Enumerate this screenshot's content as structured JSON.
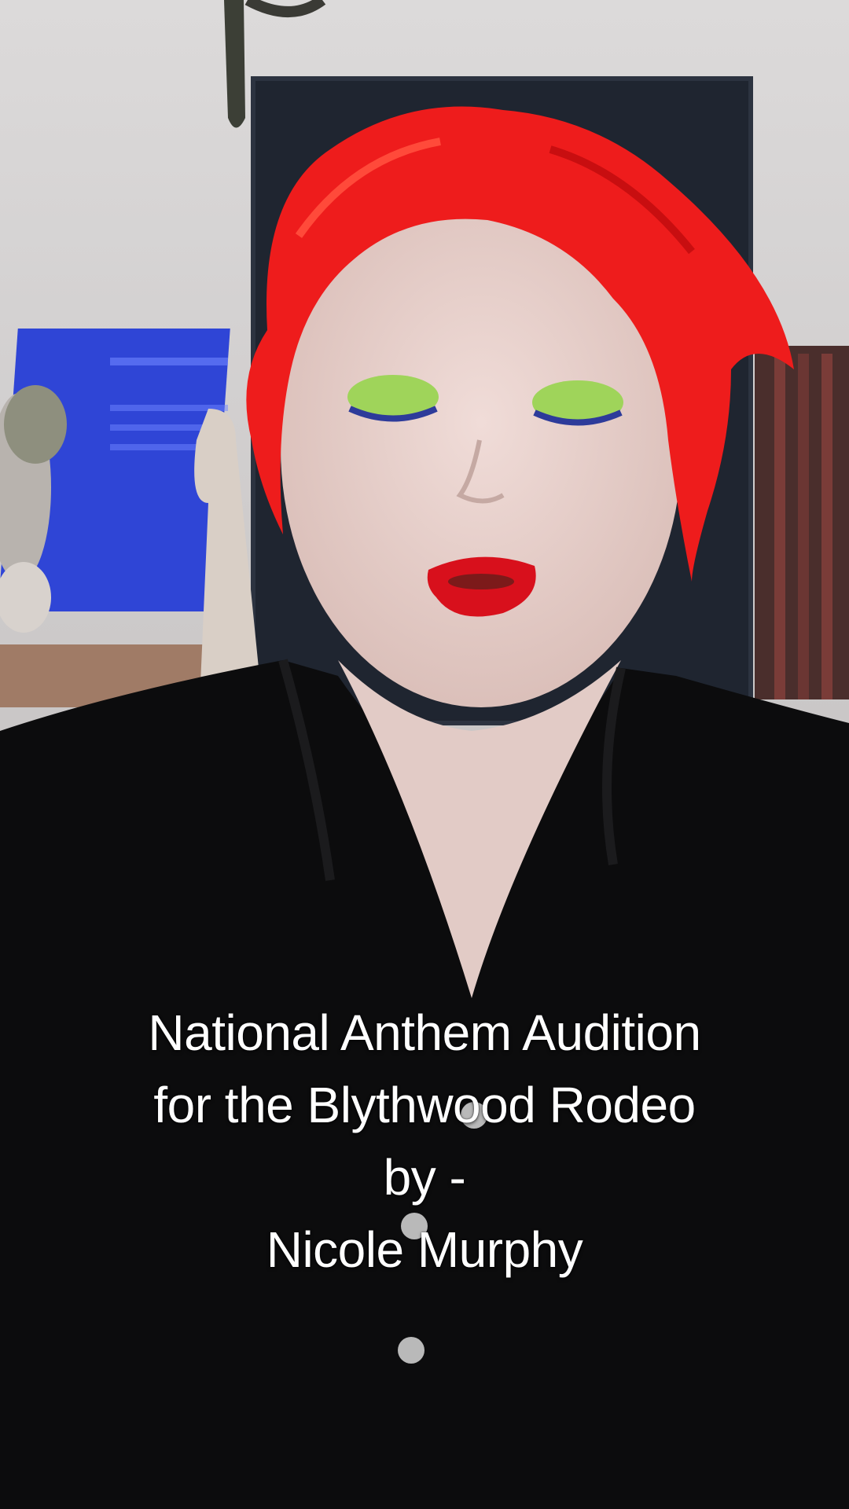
{
  "video": {
    "caption_lines": [
      "National Anthem Audition",
      "for the Blythwood Rodeo",
      "by -",
      "Nicole Murphy"
    ]
  },
  "colors": {
    "wall": "#d6d4d4",
    "hair": "#ee1c1c",
    "lips": "#d8101c",
    "eyeshadow": "#9fd45a",
    "skin": "#e8d3cf",
    "shirt": "#0c0c0d",
    "book_blue": "#2f45d6",
    "canvas_dark": "#1f2530",
    "caption_text": "#ffffff"
  }
}
